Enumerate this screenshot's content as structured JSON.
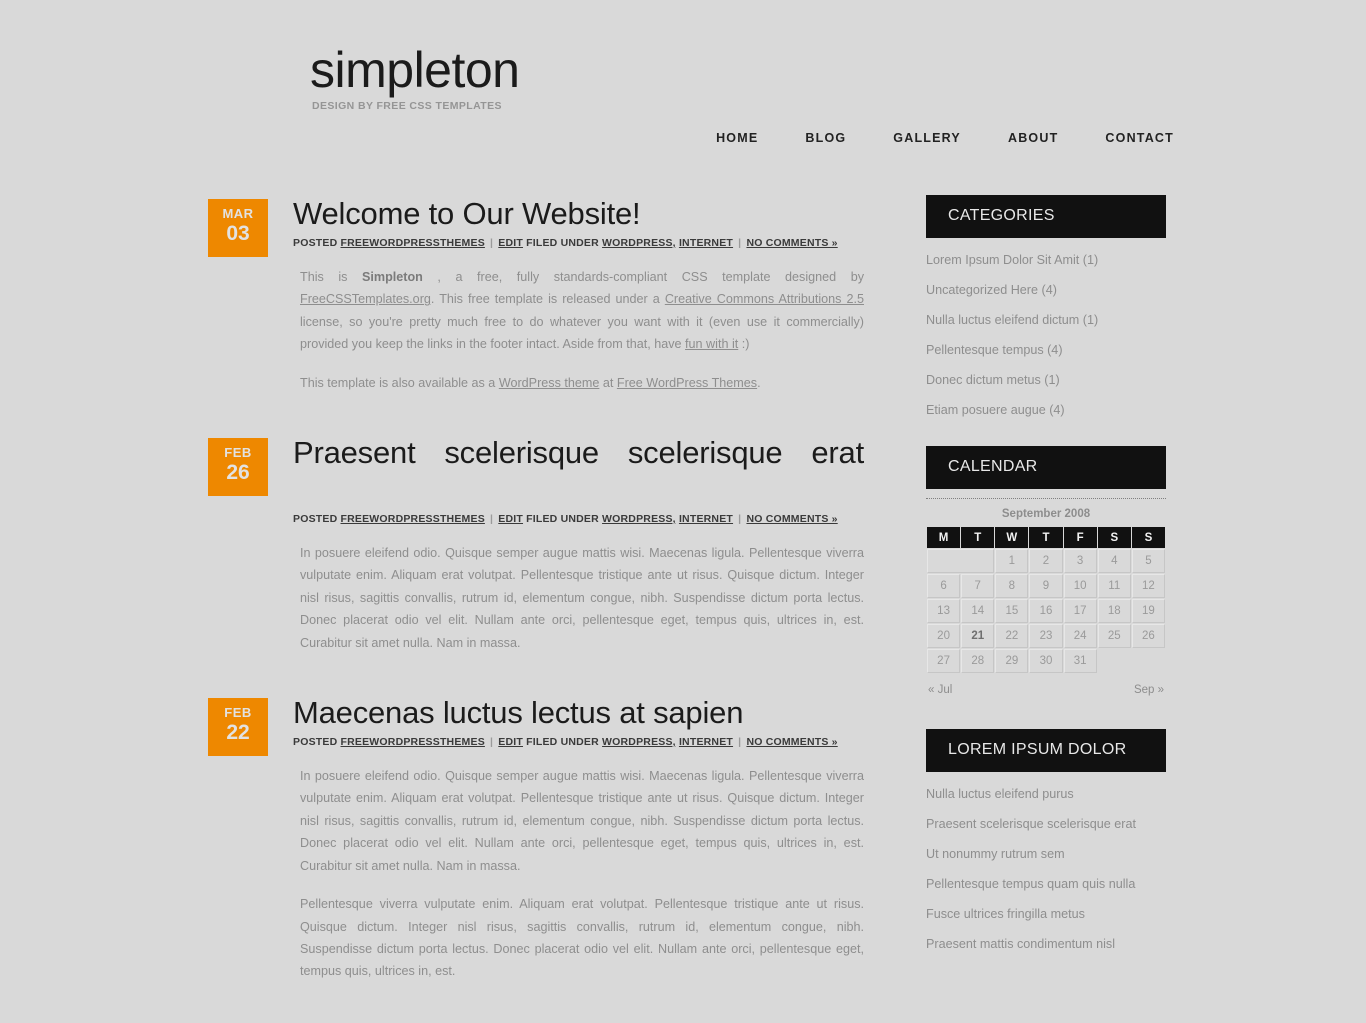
{
  "site": {
    "logo": "simpleton",
    "tagline": "DESIGN BY FREE CSS TEMPLATES",
    "colors": {
      "background": "#d9d9d9",
      "accent": "#ee8800",
      "header_bar": "#111111",
      "body_text": "#8e8e8e",
      "heading": "#1b1b1b"
    }
  },
  "nav": {
    "items": [
      {
        "label": "HOME"
      },
      {
        "label": "BLOG"
      },
      {
        "label": "GALLERY"
      },
      {
        "label": "ABOUT"
      },
      {
        "label": "CONTACT"
      }
    ]
  },
  "meta_labels": {
    "posted": "POSTED",
    "author": "FREEWORDPRESSTHEMES",
    "edit": "EDIT",
    "filed_under": "FILED UNDER",
    "cat1": "WORDPRESS,",
    "cat2": "INTERNET",
    "comments": "NO COMMENTS »",
    "sep": "|"
  },
  "posts": [
    {
      "month": "MAR",
      "day": "03",
      "title": "Welcome to Our Website!",
      "title_justified": false,
      "paragraphs": [
        {
          "segments": [
            {
              "text": "This is "
            },
            {
              "text": "Simpleton",
              "style": "strong"
            },
            {
              "text": " , a free, fully standards-compliant CSS template designed by "
            },
            {
              "text": "FreeCSSTemplates.org",
              "style": "link"
            },
            {
              "text": ". This free template is released under a "
            },
            {
              "text": "Creative Commons Attributions 2.5",
              "style": "link"
            },
            {
              "text": " license, so you're pretty much free to do whatever you want with it (even use it commercially) provided you keep the links in the footer intact. Aside from that, have "
            },
            {
              "text": "fun with it",
              "style": "link"
            },
            {
              "text": " :)"
            }
          ]
        },
        {
          "segments": [
            {
              "text": "This template is also available as a "
            },
            {
              "text": "WordPress theme",
              "style": "link"
            },
            {
              "text": " at "
            },
            {
              "text": "Free WordPress Themes",
              "style": "link"
            },
            {
              "text": "."
            }
          ]
        }
      ]
    },
    {
      "month": "FEB",
      "day": "26",
      "title": "Praesent scelerisque scelerisque erat",
      "title_justified": true,
      "paragraphs": [
        {
          "segments": [
            {
              "text": "In posuere eleifend odio. Quisque semper augue mattis wisi. Maecenas ligula. Pellentesque viverra vulputate enim. Aliquam erat volutpat. Pellentesque tristique ante ut risus. Quisque dictum. Integer nisl risus, sagittis convallis, rutrum id, elementum congue, nibh. Suspendisse dictum porta lectus. Donec placerat odio vel elit. Nullam ante orci, pellentesque eget, tempus quis, ultrices in, est. Curabitur sit amet nulla. Nam in massa."
            }
          ]
        }
      ]
    },
    {
      "month": "FEB",
      "day": "22",
      "title": "Maecenas luctus lectus at sapien",
      "title_justified": false,
      "paragraphs": [
        {
          "segments": [
            {
              "text": "In posuere eleifend odio. Quisque semper augue mattis wisi. Maecenas ligula. Pellentesque viverra vulputate enim. Aliquam erat volutpat. Pellentesque tristique ante ut risus. Quisque dictum. Integer nisl risus, sagittis convallis, rutrum id, elementum congue, nibh. Suspendisse dictum porta lectus. Donec placerat odio vel elit. Nullam ante orci, pellentesque eget, tempus quis, ultrices in, est. Curabitur sit amet nulla. Nam in massa."
            }
          ]
        },
        {
          "segments": [
            {
              "text": "Pellentesque viverra vulputate enim. Aliquam erat volutpat. Pellentesque tristique ante ut risus. Quisque dictum. Integer nisl risus, sagittis convallis, rutrum id, elementum congue, nibh. Suspendisse dictum porta lectus. Donec placerat odio vel elit. Nullam ante orci, pellentesque eget, tempus quis, ultrices in, est."
            }
          ]
        }
      ]
    }
  ],
  "sidebar": {
    "categories": {
      "title": "CATEGORIES",
      "items": [
        {
          "label": "Lorem Ipsum Dolor Sit Amit (1)"
        },
        {
          "label": "Uncategorized Here (4)"
        },
        {
          "label": "Nulla luctus eleifend dictum (1)"
        },
        {
          "label": "Pellentesque tempus (4)"
        },
        {
          "label": "Donec dictum metus (1)"
        },
        {
          "label": "Etiam posuere augue (4)"
        }
      ]
    },
    "calendar": {
      "title": "CALENDAR",
      "caption": "September 2008",
      "weekdays": [
        "M",
        "T",
        "W",
        "T",
        "F",
        "S",
        "S"
      ],
      "leading_blanks": 2,
      "days": [
        1,
        2,
        3,
        4,
        5,
        6,
        7,
        8,
        9,
        10,
        11,
        12,
        13,
        14,
        15,
        16,
        17,
        18,
        19,
        20,
        21,
        22,
        23,
        24,
        25,
        26,
        27,
        28,
        29,
        30,
        31
      ],
      "today": 21,
      "prev_label": "« Jul",
      "next_label": "Sep »"
    },
    "lorem": {
      "title": "LOREM IPSUM DOLOR",
      "items": [
        {
          "label": "Nulla luctus eleifend purus"
        },
        {
          "label": "Praesent scelerisque scelerisque erat"
        },
        {
          "label": "Ut nonummy rutrum sem"
        },
        {
          "label": "Pellentesque tempus quam quis nulla"
        },
        {
          "label": "Fusce ultrices fringilla metus"
        },
        {
          "label": "Praesent mattis condimentum nisl"
        }
      ]
    }
  }
}
